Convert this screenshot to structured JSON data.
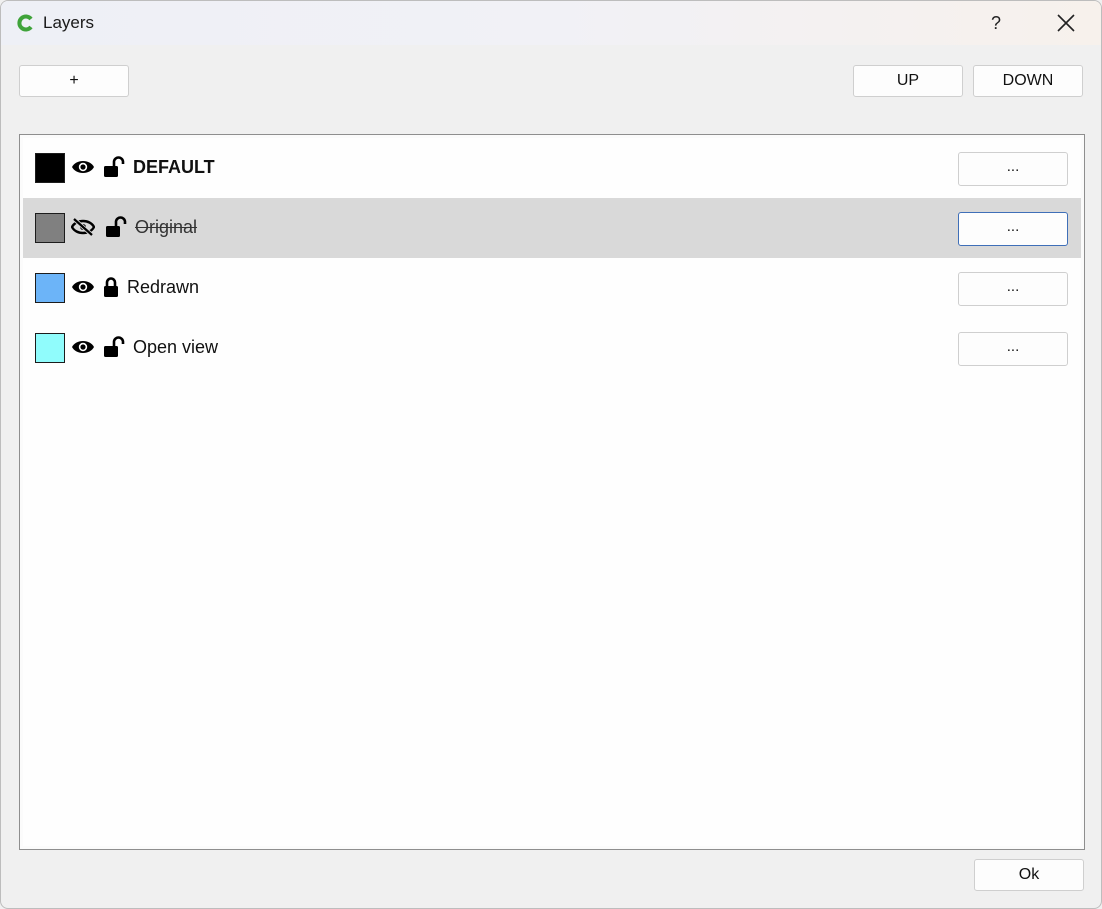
{
  "window": {
    "title": "Layers",
    "help_label": "?"
  },
  "toolbar": {
    "add_label": "+",
    "up_label": "UP",
    "down_label": "DOWN"
  },
  "layers": [
    {
      "name": "DEFAULT",
      "color": "#000000",
      "visible": true,
      "locked": false,
      "bold": true,
      "menu_label": "..."
    },
    {
      "name": "Original",
      "color": "#808080",
      "visible": false,
      "locked": false,
      "selected": true,
      "menu_label": "..."
    },
    {
      "name": "Redrawn",
      "color": "#6cb4f8",
      "visible": true,
      "locked": true,
      "menu_label": "..."
    },
    {
      "name": "Open view",
      "color": "#90fcfc",
      "visible": true,
      "locked": false,
      "menu_label": "..."
    }
  ],
  "footer": {
    "ok_label": "Ok"
  }
}
